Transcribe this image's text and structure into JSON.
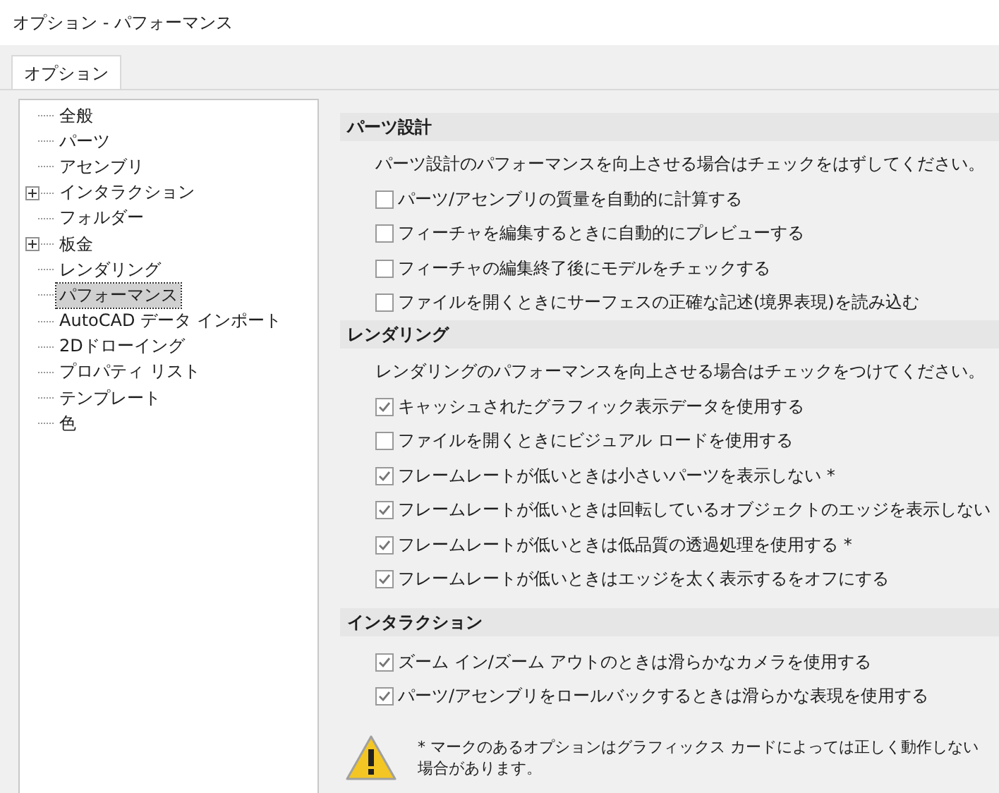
{
  "window": {
    "title": "オプション - パフォーマンス"
  },
  "tabs": [
    {
      "label": "オプション",
      "selected": true
    }
  ],
  "tree": {
    "items": [
      {
        "label": "全般",
        "selected": false
      },
      {
        "label": "パーツ",
        "selected": false
      },
      {
        "label": "アセンブリ",
        "selected": false
      },
      {
        "label": "インタラクション",
        "selected": false,
        "expanded": false
      },
      {
        "label": "フォルダー",
        "selected": false
      },
      {
        "label": "板金",
        "selected": false,
        "expanded": false
      },
      {
        "label": "レンダリング",
        "selected": false
      },
      {
        "label": "パフォーマンス",
        "selected": true
      },
      {
        "label": "AutoCAD データ インポート",
        "selected": false
      },
      {
        "label": "2Dドローイング",
        "selected": false
      },
      {
        "label": "プロパティ リスト",
        "selected": false
      },
      {
        "label": "テンプレート",
        "selected": false
      },
      {
        "label": "色",
        "selected": false
      }
    ]
  },
  "sections": [
    {
      "title": "パーツ設計",
      "description": "パーツ設計のパフォーマンスを向上させる場合はチェックをはずしてください。",
      "options": [
        {
          "label": "パーツ/アセンブリの質量を自動的に計算する",
          "checked": false
        },
        {
          "label": "フィーチャを編集するときに自動的にプレビューする",
          "checked": false
        },
        {
          "label": "フィーチャの編集終了後にモデルをチェックする",
          "checked": false
        },
        {
          "label": "ファイルを開くときにサーフェスの正確な記述(境界表現)を読み込む",
          "checked": false
        }
      ]
    },
    {
      "title": "レンダリング",
      "description": "レンダリングのパフォーマンスを向上させる場合はチェックをつけてください。",
      "options": [
        {
          "label": "キャッシュされたグラフィック表示データを使用する",
          "checked": true
        },
        {
          "label": "ファイルを開くときにビジュアル ロードを使用する",
          "checked": false
        },
        {
          "label": "フレームレートが低いときは小さいパーツを表示しない *",
          "checked": true
        },
        {
          "label": "フレームレートが低いときは回転しているオブジェクトのエッジを表示しない",
          "checked": true
        },
        {
          "label": "フレームレートが低いときは低品質の透過処理を使用する *",
          "checked": true
        },
        {
          "label": "フレームレートが低いときはエッジを太く表示するをオフにする",
          "checked": true
        }
      ]
    },
    {
      "title": "インタラクション",
      "options": [
        {
          "label": "ズーム イン/ズーム アウトのときは滑らかなカメラを使用する",
          "checked": true
        },
        {
          "label": "パーツ/アセンブリをロールバックするときは滑らかな表現を使用する",
          "checked": true
        }
      ]
    }
  ],
  "warning": {
    "text": "* マークのあるオプションはグラフィックス カードによっては正しく動作しない場合があります。"
  }
}
